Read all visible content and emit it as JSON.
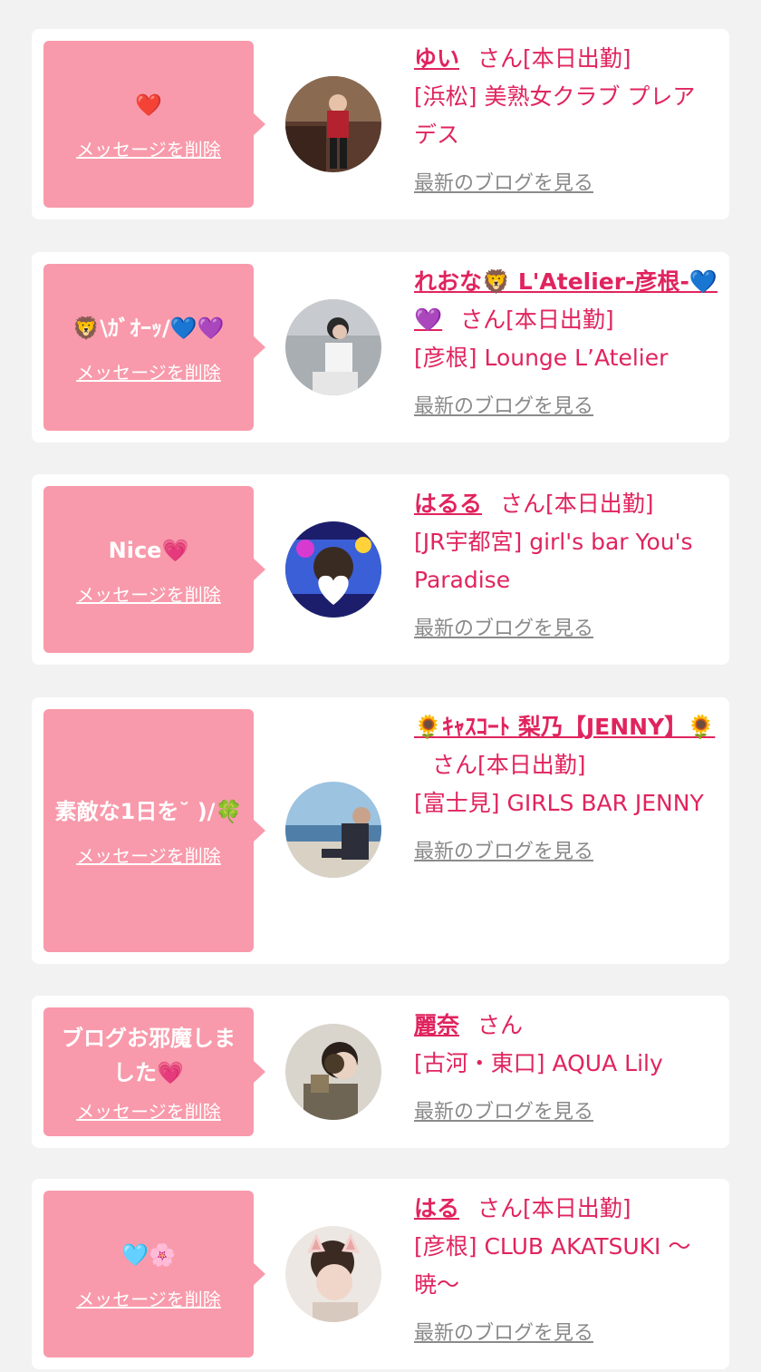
{
  "delete_label": "メッセージを削除",
  "blog_label": "最新のブログを見る",
  "san_suffix": "さん",
  "items": [
    {
      "message": "❤️",
      "name": "ゆい",
      "status": "さん[本日出勤]",
      "shop": "[浜松] 美熟女クラブ プレアデス"
    },
    {
      "message": "🦁\\ｶﾞｵｰｯ/💙💜",
      "name": "れおな🦁 L'Atelier-彦根-💙💜",
      "status": "さん[本日出勤]",
      "shop": "[彦根] Lounge L’Atelier"
    },
    {
      "message": "Nice💗",
      "name": "はるる",
      "status": "さん[本日出勤]",
      "shop": "[JR宇都宮] girl's bar You's Paradise"
    },
    {
      "message": "素敵な1日を˘ )/🍀",
      "name": "🌻ｷｬｽｺｰﾄ 梨乃【JENNY】🌻",
      "status": "さん[本日出勤]",
      "shop": "[富士見] GIRLS BAR JENNY"
    },
    {
      "message": "ブログお邪魔しました💗",
      "name": "麗奈",
      "status": "さん",
      "shop": "[古河・東口] AQUA Lily"
    },
    {
      "message": "🩵🌸",
      "name": "はる",
      "status": "さん[本日出勤]",
      "shop": "[彦根] CLUB AKATSUKI 〜暁〜"
    }
  ]
}
